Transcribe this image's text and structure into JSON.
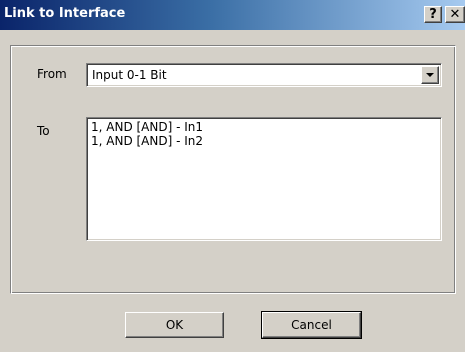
{
  "window": {
    "title": "Link to Interface",
    "help_label": "?",
    "close_label": "✕"
  },
  "from": {
    "label": "From",
    "selected": "Input 0-1 Bit"
  },
  "to": {
    "label": "To",
    "items": [
      "1, AND [AND] - In1",
      "1, AND [AND] - In2"
    ]
  },
  "buttons": {
    "ok": "OK",
    "cancel": "Cancel"
  }
}
